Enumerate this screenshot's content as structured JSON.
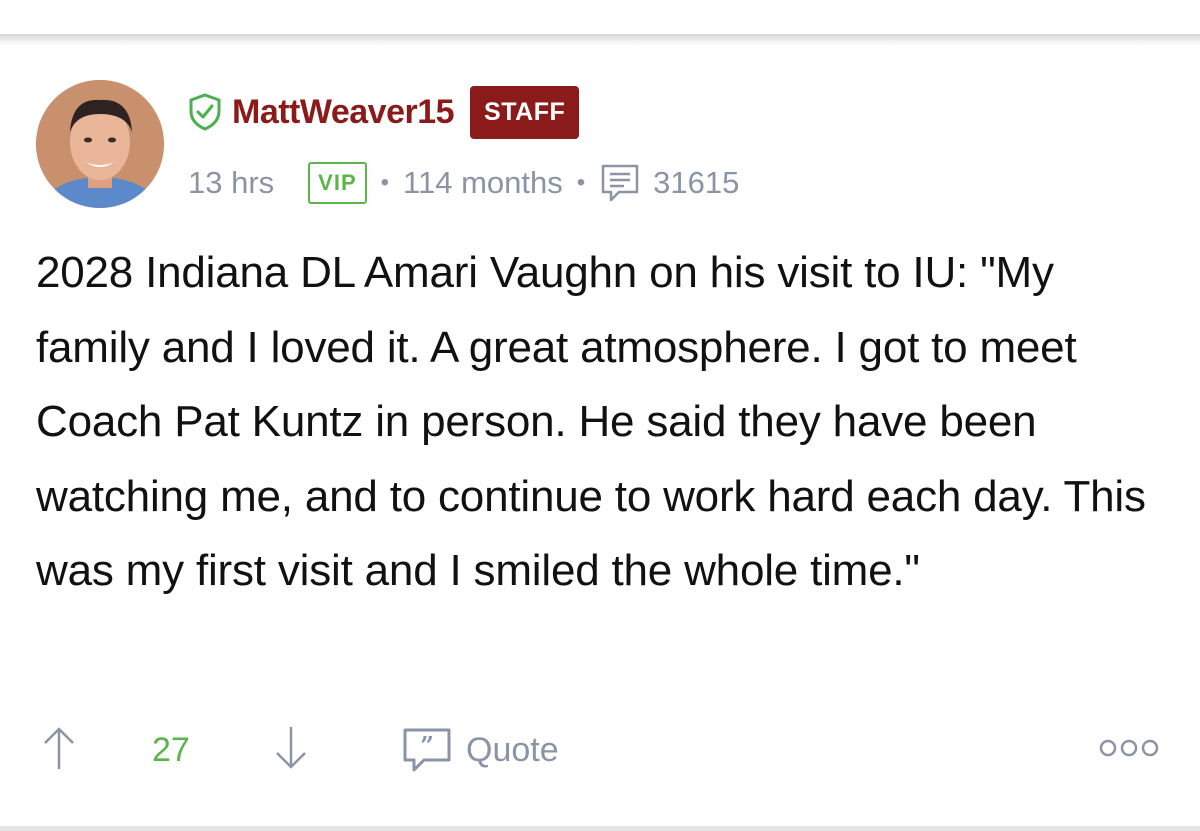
{
  "post": {
    "author": {
      "username": "MattWeaver15",
      "role_badge": "STAFF",
      "verified_icon": "shield-check-icon"
    },
    "meta": {
      "time_ago": "13 hrs",
      "membership_badge": "VIP",
      "separator": "•",
      "member_duration": "114 months",
      "post_count": "31615"
    },
    "body": "2028 Indiana DL Amari Vaughn on his visit to IU: \"My family and I loved it. A great atmosphere. I got to meet Coach Pat Kuntz in person. He said they have been watching me, and to continue to work hard each day. This was my first visit and I smiled the whole time.\"",
    "actions": {
      "upvote_icon": "arrow-up-icon",
      "upvote_count": "27",
      "downvote_icon": "arrow-down-icon",
      "quote_label": "Quote",
      "quote_icon": "quote-bubble-icon",
      "more_icon": "more-options-icon"
    }
  },
  "colors": {
    "staff": "#8b1a1a",
    "vip": "#5db54a",
    "meta_text": "#8a94a6",
    "verified": "#4caf50"
  }
}
